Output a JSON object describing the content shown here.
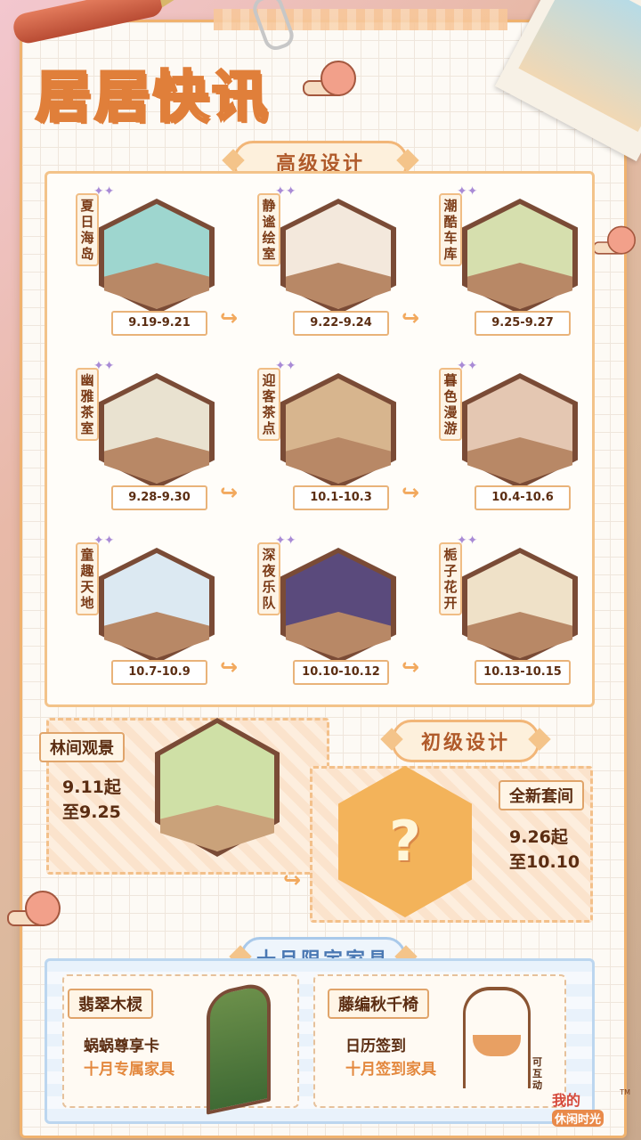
{
  "header": {
    "title": "居居快讯"
  },
  "advanced": {
    "banner": "高级设计",
    "rooms": [
      {
        "name": "夏日海岛",
        "date": "9.19-9.21",
        "color": "#9ed6cf"
      },
      {
        "name": "静谧绘室",
        "date": "9.22-9.24",
        "color": "#f3e8dc"
      },
      {
        "name": "潮酷车库",
        "date": "9.25-9.27",
        "color": "#d6dfae"
      },
      {
        "name": "幽雅茶室",
        "date": "9.28-9.30",
        "color": "#e9e2d0"
      },
      {
        "name": "迎客茶点",
        "date": "10.1-10.3",
        "color": "#d7b58e"
      },
      {
        "name": "暮色漫游",
        "date": "10.4-10.6",
        "color": "#e4c7b2"
      },
      {
        "name": "童趣天地",
        "date": "10.7-10.9",
        "color": "#dce9f2"
      },
      {
        "name": "深夜乐队",
        "date": "10.10-10.12",
        "color": "#5a4a7c"
      },
      {
        "name": "栀子花开",
        "date": "10.13-10.15",
        "color": "#efe1c8"
      }
    ]
  },
  "basic": {
    "banner": "初级设计",
    "current": {
      "name": "林间观景",
      "date_line1": "9.11起",
      "date_line2": "至9.25"
    },
    "next": {
      "name": "全新套间",
      "date_line1": "9.26起",
      "date_line2": "至10.10",
      "mystery": "?"
    }
  },
  "october": {
    "banner": "十月限定家具",
    "left": {
      "name": "翡翠木棂",
      "line1": "蜗蜗尊享卡",
      "line2": "十月专属家具"
    },
    "right": {
      "name": "藤编秋千椅",
      "line1": "日历签到",
      "line2": "十月签到家具",
      "badge": "可互动"
    }
  },
  "logo": {
    "text_line1": "我的",
    "text_line2": "休闲时光",
    "tm": "TM"
  }
}
